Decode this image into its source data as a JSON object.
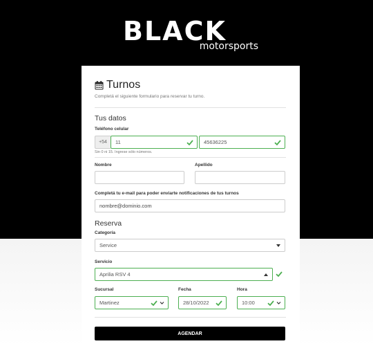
{
  "brand": {
    "name": "BLACK",
    "tagline": "motorsports"
  },
  "form": {
    "title": "Turnos",
    "subtitle": "Completá el siguiente formulario para reservar tu turno.",
    "datos_section": "Tus datos",
    "telefono": {
      "label": "Teléfono celular",
      "prefix": "+54",
      "area_value": "11",
      "number_value": "45636225",
      "help": "Sin 0 ni 15. Ingrese sólo números."
    },
    "nombre": {
      "label": "Nombre",
      "value": ""
    },
    "apellido": {
      "label": "Apellido",
      "value": ""
    },
    "email": {
      "label": "Completá tu e-mail para poder enviarte notificaciones de tus turnos",
      "placeholder": "nombre@dominio.com"
    },
    "reserva_section": "Reserva",
    "categoria": {
      "label": "Categoría",
      "value": "Service"
    },
    "servicio": {
      "label": "Servicio",
      "value": "Aprilia RSV 4"
    },
    "sucursal": {
      "label": "Sucursal",
      "value": "Martinez"
    },
    "fecha": {
      "label": "Fecha",
      "value": "28/10/2022"
    },
    "hora": {
      "label": "Hora",
      "value": "10:00"
    },
    "submit_label": "AGENDAR"
  },
  "colors": {
    "valid": "#4caf50",
    "button": "#000000",
    "header_bg": "#000000"
  },
  "icons": [
    "calendar-icon",
    "check-icon",
    "chevron-down-icon",
    "caret-up-icon"
  ]
}
